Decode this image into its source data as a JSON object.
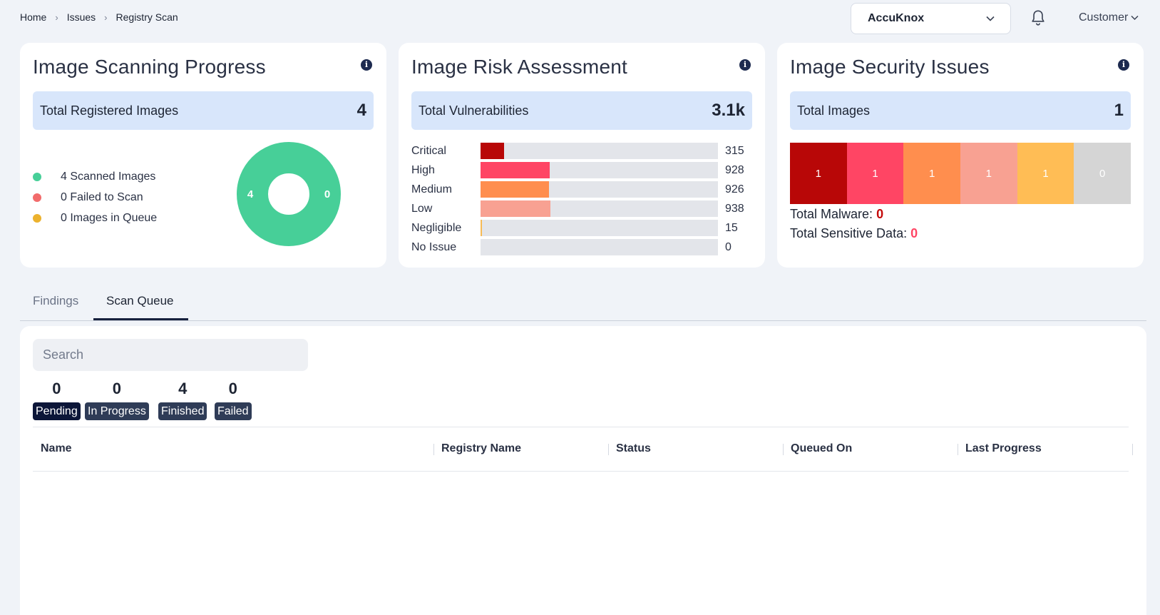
{
  "breadcrumb": [
    "Home",
    "Issues",
    "Registry Scan"
  ],
  "header": {
    "org_name": "AccuKnox",
    "user_menu": "Customer"
  },
  "scanning_progress": {
    "title": "Image Scanning Progress",
    "total_label": "Total Registered Images",
    "total_value": "4",
    "legend": [
      {
        "label": "4 Scanned Images",
        "color": "#47cf98"
      },
      {
        "label": "0 Failed to Scan",
        "color": "#f26b6b"
      },
      {
        "label": "0 Images in Queue",
        "color": "#ecb22e"
      }
    ],
    "donut": {
      "left_value": "4",
      "right_value": "0",
      "color": "#47cf98"
    }
  },
  "risk_assessment": {
    "title": "Image Risk Assessment",
    "total_label": "Total Vulnerabilities",
    "total_value": "3.1k",
    "max": 3200,
    "rows": [
      {
        "label": "Critical",
        "value": 315,
        "color": "#b80707"
      },
      {
        "label": "High",
        "value": 928,
        "color": "#ff4564"
      },
      {
        "label": "Medium",
        "value": 926,
        "color": "#ff8e4e"
      },
      {
        "label": "Low",
        "value": 938,
        "color": "#f8a192"
      },
      {
        "label": "Negligible",
        "value": 15,
        "color": "#f7bb55"
      },
      {
        "label": "No Issue",
        "value": 0,
        "color": "#d5d5d5"
      }
    ]
  },
  "security_issues": {
    "title": "Image Security Issues",
    "total_label": "Total Images",
    "total_value": "1",
    "cells": [
      {
        "value": "1",
        "color": "#b80707"
      },
      {
        "value": "1",
        "color": "#ff4564"
      },
      {
        "value": "1",
        "color": "#ff8e4e"
      },
      {
        "value": "1",
        "color": "#f8a192"
      },
      {
        "value": "1",
        "color": "#ffbd55"
      },
      {
        "value": "0",
        "color": "#d5d5d5"
      }
    ],
    "malware_label": "Total Malware:",
    "malware_value": "0",
    "malware_color": "#c40a0a",
    "sensitive_label": "Total Sensitive Data:",
    "sensitive_value": "0",
    "sensitive_color": "#ff4564"
  },
  "tabs": [
    {
      "label": "Findings",
      "active": false
    },
    {
      "label": "Scan Queue",
      "active": true
    }
  ],
  "search": {
    "placeholder": "Search",
    "value": ""
  },
  "queue_stats": [
    {
      "count": "0",
      "label": "Pending",
      "color": "#0c1638"
    },
    {
      "count": "0",
      "label": "In Progress",
      "color": "#2f3c57"
    },
    {
      "count": "4",
      "label": "Finished",
      "color": "#2f3c57"
    },
    {
      "count": "0",
      "label": "Failed",
      "color": "#2f3c57"
    }
  ],
  "table": {
    "columns": [
      "Name",
      "Registry Name",
      "Status",
      "Queued On",
      "Last Progress"
    ],
    "rows": []
  }
}
